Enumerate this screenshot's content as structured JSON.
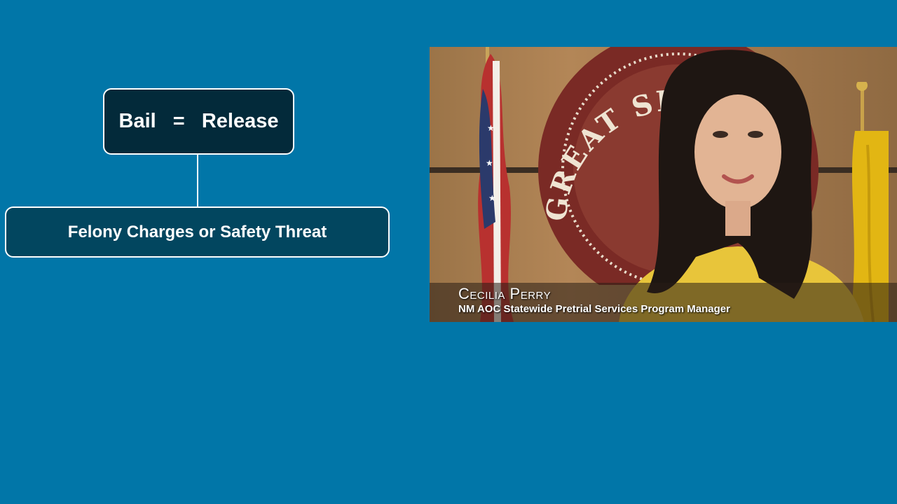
{
  "diagram": {
    "top_box": "Bail  =  Release",
    "bottom_box": "Felony Charges or Safety Threat"
  },
  "video": {
    "speaker_name": "Cecilia Perry",
    "speaker_title": "NM AOC Statewide Pretrial Services Program Manager",
    "seal_text": "GREAT SEAL OF THE STATE OF NEW MEXICO"
  },
  "colors": {
    "background": "#0176a8",
    "top_box": "#032a3a",
    "bottom_box": "#02465f"
  }
}
